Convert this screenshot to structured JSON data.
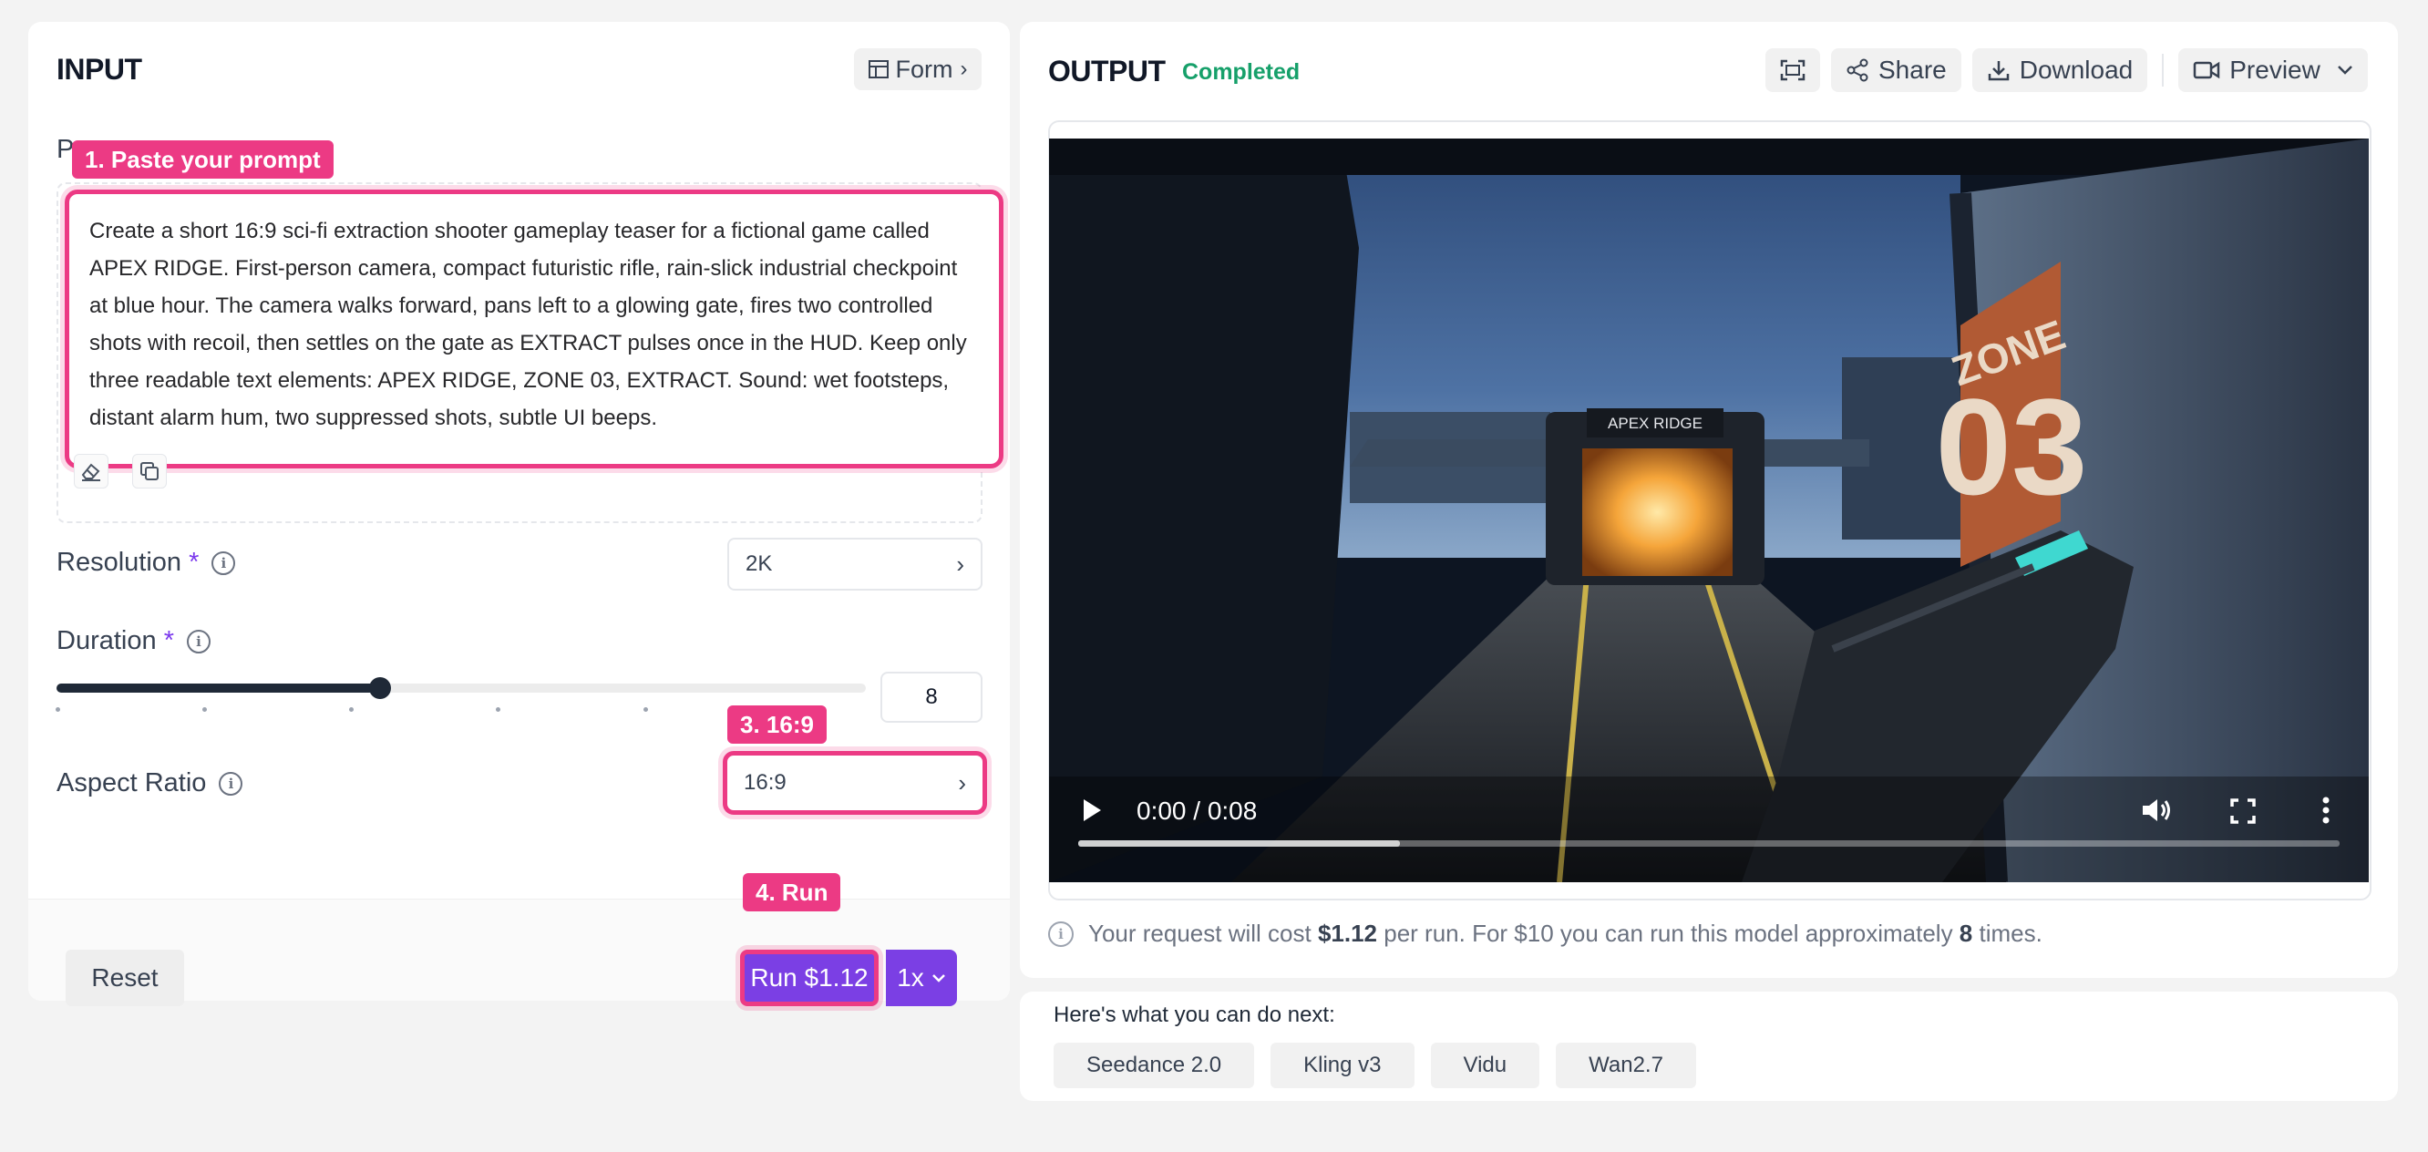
{
  "input": {
    "title": "INPUT",
    "form_label": "Form",
    "prompt_label": "P",
    "prompt_text": "Create a short 16:9 sci-fi extraction shooter gameplay teaser for a fictional game called APEX RIDGE. First-person camera, compact futuristic rifle, rain-slick industrial checkpoint at blue hour. The camera walks forward, pans left to a glowing gate, fires two controlled shots with recoil, then settles on the gate as EXTRACT pulses once in the HUD. Keep only three readable text elements: APEX RIDGE, ZONE 03, EXTRACT. Sound: wet footsteps, distant alarm hum, two suppressed shots, subtle UI beeps.",
    "resolution": {
      "label": "Resolution",
      "required": "*",
      "value": "2K"
    },
    "duration": {
      "label": "Duration",
      "required": "*",
      "value": "8",
      "slider_fraction": 0.4
    },
    "aspect_ratio": {
      "label": "Aspect Ratio",
      "value": "16:9"
    },
    "reset_label": "Reset",
    "run_label": "Run $1.12",
    "multiplier": "1x"
  },
  "callouts": {
    "c1": "1. Paste your prompt",
    "c3": "3. 16:9",
    "c4": "4. Run"
  },
  "output": {
    "title": "OUTPUT",
    "status": "Completed",
    "share_label": "Share",
    "download_label": "Download",
    "preview_label": "Preview",
    "video": {
      "time": "0:00 / 0:08",
      "progress_fraction": 0.255,
      "sign_apex": "APEX RIDGE",
      "sign_zone_top": "ZONE",
      "sign_zone_num": "03"
    },
    "cost": {
      "prefix": "Your request will cost ",
      "amount": "$1.12",
      "middle": " per run. For $10 you can run this model approximately ",
      "count": "8",
      "suffix": " times."
    }
  },
  "next": {
    "title": "Here's what you can do next:",
    "chips": [
      "Seedance 2.0",
      "Kling v3",
      "Vidu",
      "Wan2.7"
    ]
  },
  "colors": {
    "accent": "#7b3fe4",
    "highlight": "#ec3a84",
    "status_green": "#16a06a"
  }
}
